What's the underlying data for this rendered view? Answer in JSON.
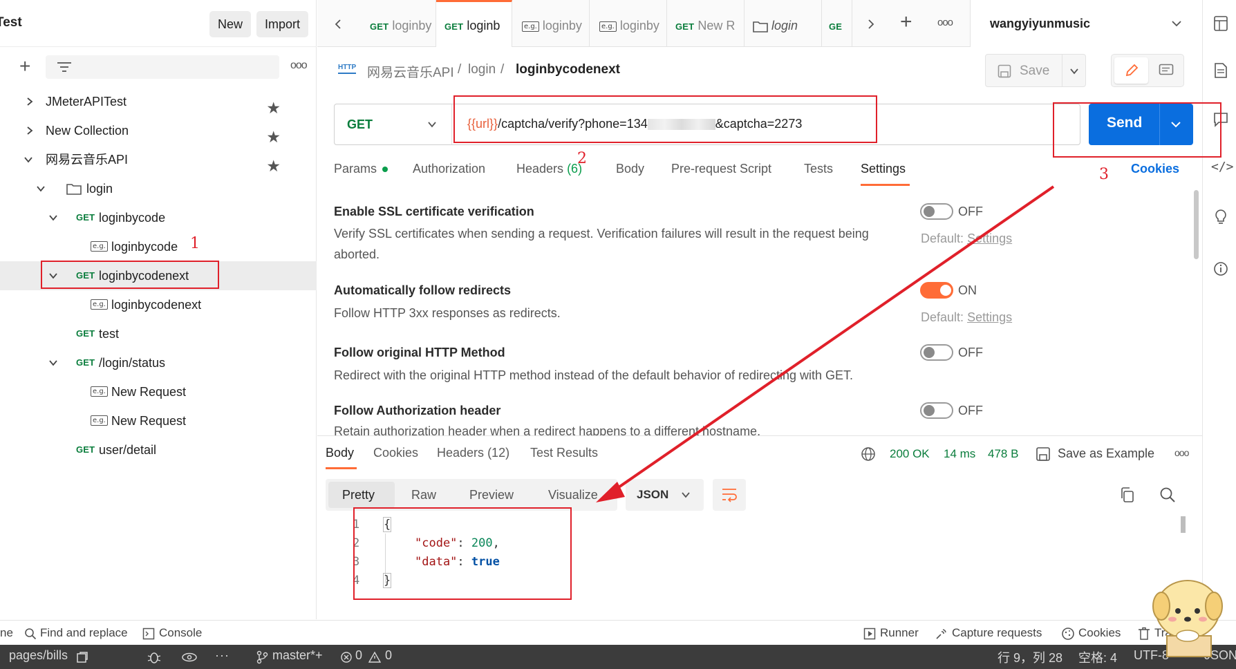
{
  "sidebar": {
    "workspace_title": "Test",
    "new_button": "New",
    "import_button": "Import",
    "more": "ooo",
    "tree": [
      {
        "label": "JMeterAPITest"
      },
      {
        "label": "New Collection"
      },
      {
        "label": "网易云音乐API"
      },
      {
        "label": "login"
      },
      {
        "method": "GET",
        "label": "loginbycode"
      },
      {
        "badge": "e.g.",
        "label": "loginbycode"
      },
      {
        "method": "GET",
        "label": "loginbycodenext"
      },
      {
        "badge": "e.g.",
        "label": "loginbycodenext"
      },
      {
        "method": "GET",
        "label": "test"
      },
      {
        "method": "GET",
        "label": "/login/status"
      },
      {
        "badge": "e.g.",
        "label": "New Request"
      },
      {
        "badge": "e.g.",
        "label": "New Request"
      },
      {
        "method": "GET",
        "label": "user/detail"
      }
    ]
  },
  "tabs": [
    {
      "prefix": "GET",
      "label": "loginby"
    },
    {
      "prefix": "GET",
      "label": "loginb"
    },
    {
      "prefix": "e.g.",
      "label": "loginby"
    },
    {
      "prefix": "e.g.",
      "label": "loginby"
    },
    {
      "prefix": "GET",
      "label": "New R"
    },
    {
      "prefix": "",
      "label": "login"
    },
    {
      "prefix": "GE",
      "label": ""
    }
  ],
  "environment": "wangyiyunmusic",
  "breadcrumb": {
    "http_badge": "HTTP",
    "collection": "网易云音乐API",
    "sep": "/",
    "folder": "login",
    "request": "loginbycodenext"
  },
  "save_label": "Save",
  "request": {
    "method": "GET",
    "url_var": "{{url}}",
    "url_rest": "/captcha/verify?phone=134",
    "url_tail": "&captcha=2273",
    "send_label": "Send"
  },
  "request_tabs": {
    "params": "Params",
    "authorization": "Authorization",
    "headers": "Headers",
    "headers_count": "(6)",
    "body": "Body",
    "prerequest": "Pre-request Script",
    "tests": "Tests",
    "settings": "Settings",
    "cookies": "Cookies"
  },
  "settings": [
    {
      "title": "Enable SSL certificate verification",
      "desc": "Verify SSL certificates when sending a request. Verification failures will result in the request being aborted.",
      "state": "OFF",
      "default_prefix": "Default:",
      "default_link": "Settings"
    },
    {
      "title": "Automatically follow redirects",
      "desc": "Follow HTTP 3xx responses as redirects.",
      "state": "ON",
      "default_prefix": "Default:",
      "default_link": "Settings"
    },
    {
      "title": "Follow original HTTP Method",
      "desc": "Redirect with the original HTTP method instead of the default behavior of redirecting with GET.",
      "state": "OFF"
    },
    {
      "title": "Follow Authorization header",
      "desc": "Retain authorization header when a redirect happens to a different hostname.",
      "state": "OFF"
    }
  ],
  "response": {
    "tabs": {
      "body": "Body",
      "cookies": "Cookies",
      "headers": "Headers",
      "headers_count": "(12)",
      "test_results": "Test Results"
    },
    "status": "200 OK",
    "time": "14 ms",
    "size": "478 B",
    "save_example": "Save as Example",
    "views": {
      "pretty": "Pretty",
      "raw": "Raw",
      "preview": "Preview",
      "visualize": "Visualize"
    },
    "format": "JSON",
    "lines": [
      "1",
      "2",
      "3",
      "4"
    ],
    "json": {
      "open": "{",
      "key_code": "\"code\"",
      "colon": ":",
      "val_code": "200",
      "comma": ",",
      "key_data": "\"data\"",
      "val_data": "true",
      "close": "}"
    }
  },
  "annotations": {
    "n1": "1",
    "n2": "2",
    "n3": "3"
  },
  "footer": {
    "find_replace": "Find and replace",
    "console": "Console",
    "runner": "Runner",
    "capture": "Capture requests",
    "cookies": "Cookies",
    "trash": "Tra",
    "left_cut": "ne"
  },
  "statusbar": {
    "path": "pages/bills",
    "branch": "master*+",
    "errors": "0",
    "warnings": "0",
    "position": "行 9，列 28",
    "spaces": "空格: 4",
    "encoding": "UTF-8",
    "right_cut": "JSON"
  },
  "colors": {
    "accent": "#ff6c37",
    "send": "#0a6edf",
    "method_get": "#0a7d3c",
    "annotation": "#e0202a",
    "ok": "#0a7d3c"
  }
}
